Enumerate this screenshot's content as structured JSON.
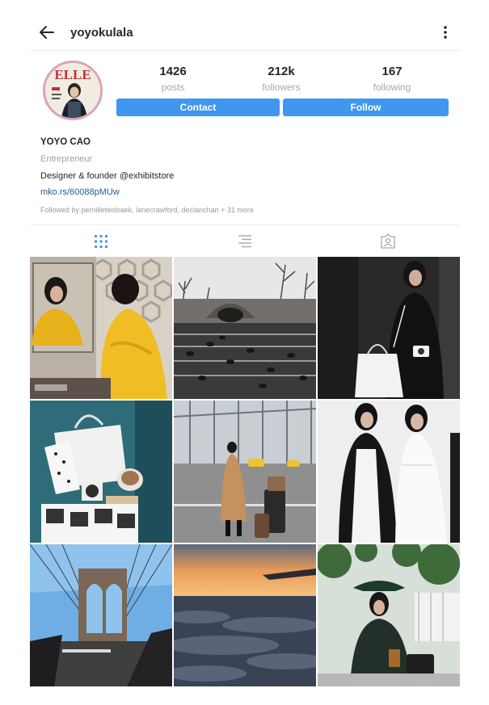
{
  "header": {
    "username": "yoyokulala",
    "back_icon": "arrow-left-icon",
    "menu_icon": "more-vertical-icon"
  },
  "profile": {
    "avatar_text": "ELLE",
    "stats": [
      {
        "value": "1426",
        "label": "posts"
      },
      {
        "value": "212k",
        "label": "followers"
      },
      {
        "value": "167",
        "label": "following"
      }
    ],
    "contact_label": "Contact",
    "follow_label": "Follow",
    "button_color": "#3f97f0"
  },
  "bio": {
    "name": "YOYO CAO",
    "category": "Entrepreneur",
    "description": "Designer & founder @exhibitstore",
    "link": "mko.rs/60088pMUw",
    "followed_by": "Followed by pernilleteisbaek, lanecrawford, declanchan + 31 more"
  },
  "tabs": [
    {
      "icon": "grid-icon",
      "active": true
    },
    {
      "icon": "list-icon",
      "active": false
    },
    {
      "icon": "tagged-icon",
      "active": false
    }
  ],
  "posts": [
    {
      "subject": "yellow-fur-coat-mirror"
    },
    {
      "subject": "park-pond-ducks"
    },
    {
      "subject": "black-outfit-white-bag"
    },
    {
      "subject": "white-bag-flatlay"
    },
    {
      "subject": "camel-coat-street"
    },
    {
      "subject": "two-women-black-white"
    },
    {
      "subject": "brooklyn-bridge"
    },
    {
      "subject": "clouds-from-plane"
    },
    {
      "subject": "woman-green-hat-cafe"
    }
  ]
}
